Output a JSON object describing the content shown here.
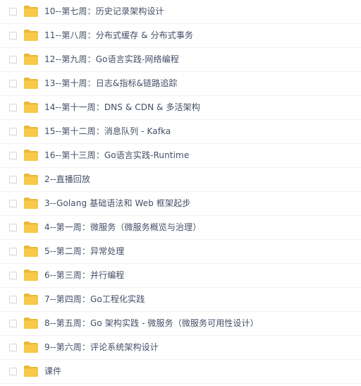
{
  "folder_list": {
    "items": [
      {
        "name": "10--第七周：历史记录架构设计"
      },
      {
        "name": "11--第八周：分布式缓存 & 分布式事务"
      },
      {
        "name": "12--第九周：Go语言实践-网络编程"
      },
      {
        "name": "13--第十周：日志&指标&链路追踪"
      },
      {
        "name": "14--第十一周：DNS & CDN & 多活架构"
      },
      {
        "name": "15--第十二周：消息队列 - Kafka"
      },
      {
        "name": "16--第十三周：Go语言实践-Runtime"
      },
      {
        "name": "2--直播回放"
      },
      {
        "name": "3--Golang 基础语法和 Web 框架起步"
      },
      {
        "name": "4--第一周：微服务（微服务概览与治理）"
      },
      {
        "name": "5--第二周：异常处理"
      },
      {
        "name": "6--第三周：并行编程"
      },
      {
        "name": "7--第四周：Go工程化实践"
      },
      {
        "name": "8--第五周：Go 架构实践 - 微服务（微服务可用性设计）"
      },
      {
        "name": "9--第六周：评论系统架构设计"
      },
      {
        "name": "课件"
      }
    ]
  },
  "colors": {
    "folder": "#f8c84a",
    "folder_back": "#f2b52f",
    "text": "#424e67",
    "checkbox_border": "#cfd3d9",
    "row_divider": "#f1f2f4"
  },
  "icons": {
    "row_icon": "folder-icon",
    "row_select": "checkbox"
  }
}
